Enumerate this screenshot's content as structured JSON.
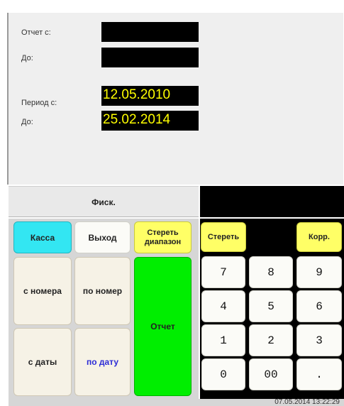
{
  "report": {
    "from_label": "Отчет с:",
    "to_label": "До:",
    "from_value": "",
    "to_value": ""
  },
  "period": {
    "from_label": "Период с:",
    "to_label": "До:",
    "from_value": "12.05.2010",
    "to_value": "25.02.2014"
  },
  "fisk_label": "Фиск.",
  "display_value": "",
  "keypad": {
    "kassa": "Касса",
    "exit": "Выход",
    "clear_range": "Стереть диапазон",
    "from_number": "с номера",
    "to_number": "по номер",
    "report": "Отчет",
    "from_date": "с даты",
    "to_date": "по дату"
  },
  "numpad": {
    "clear": "Стереть",
    "correct": "Корр.",
    "keys": [
      "7",
      "8",
      "9",
      "4",
      "5",
      "6",
      "1",
      "2",
      "3",
      "0",
      "00",
      "."
    ]
  },
  "status": {
    "datetime": "07.05.2014 13:22:29"
  },
  "colors": {
    "date_text": "#ffff00",
    "kassa": "#33e6f2",
    "yellow": "#ffff66",
    "report_green": "#00ee00",
    "to_date_text": "#2b2bd6"
  }
}
